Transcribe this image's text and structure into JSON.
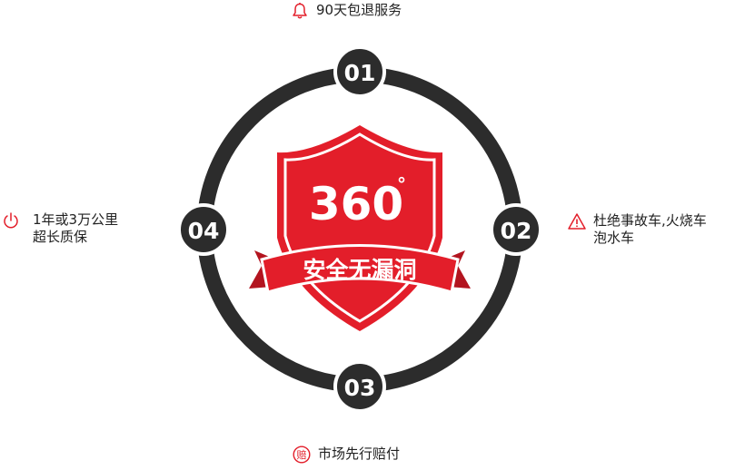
{
  "colors": {
    "ring": "#2c2c2c",
    "accent": "#e31e2a",
    "text": "#222222",
    "white": "#ffffff"
  },
  "shield": {
    "number": "360",
    "degree": "°",
    "banner": "安全无漏洞"
  },
  "nodes": [
    "01",
    "02",
    "03",
    "04"
  ],
  "features": [
    {
      "icon": "bell-icon",
      "lines": [
        "90天包退服务"
      ]
    },
    {
      "icon": "warning-icon",
      "lines": [
        "杜绝事故车,火烧车",
        "泡水车"
      ]
    },
    {
      "icon": "compensation-icon",
      "icon_text": "赔",
      "lines": [
        "市场先行赔付"
      ]
    },
    {
      "icon": "power-icon",
      "lines": [
        "1年或3万公里",
        "超长质保"
      ]
    }
  ]
}
